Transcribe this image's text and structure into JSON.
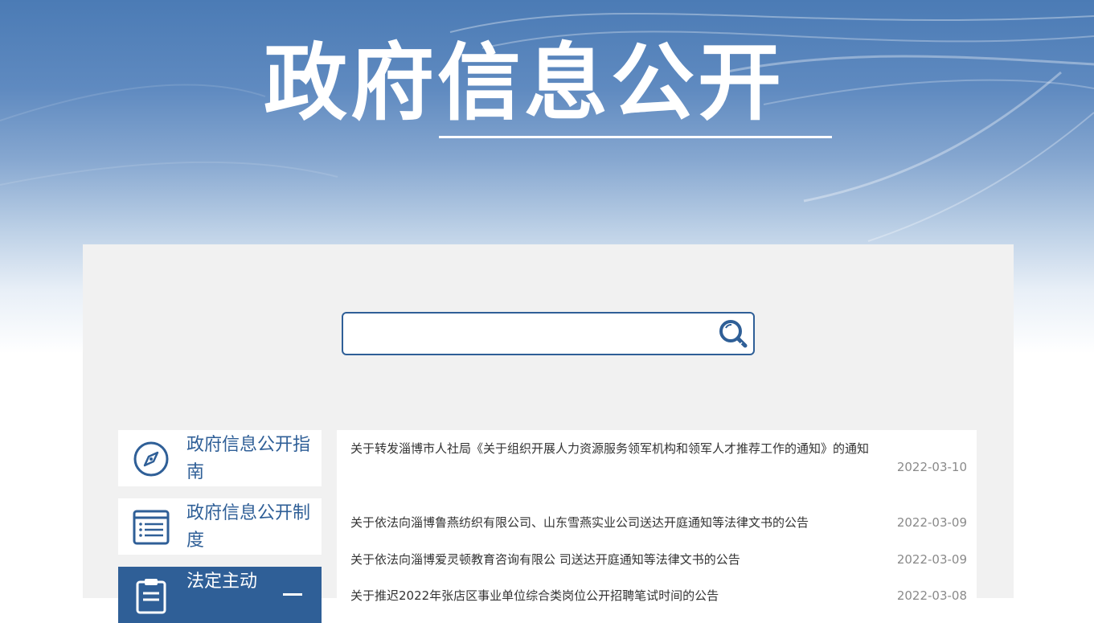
{
  "banner": {
    "title": "政府信息公开"
  },
  "search": {
    "placeholder": "",
    "value": ""
  },
  "sidebar": {
    "items": [
      {
        "label": "政府信息公开指南",
        "icon": "compass-icon"
      },
      {
        "label": "政府信息公开制度",
        "icon": "list-document-icon"
      },
      {
        "label": "法定主动",
        "icon": "clipboard-icon",
        "active": true
      }
    ]
  },
  "news": {
    "items": [
      {
        "title": "关于转发淄博市人社局《关于组织开展人力资源服务领军机构和领军人才推荐工作的通知》的通知",
        "date": "2022-03-10"
      },
      {
        "title": "关于依法向淄博鲁燕纺织有限公司、山东雪燕实业公司送达开庭通知等法律文书的公告",
        "date": "2022-03-09"
      },
      {
        "title": "关于依法向淄博爱灵顿教育咨询有限公 司送达开庭通知等法律文书的公告",
        "date": "2022-03-09"
      },
      {
        "title": "关于推迟2022年张店区事业单位综合类岗位公开招聘笔试时间的公告",
        "date": "2022-03-08"
      }
    ]
  },
  "colors": {
    "accent": "#2f5f97",
    "panel": "#f1f1f1",
    "date": "#8a8a8a"
  }
}
